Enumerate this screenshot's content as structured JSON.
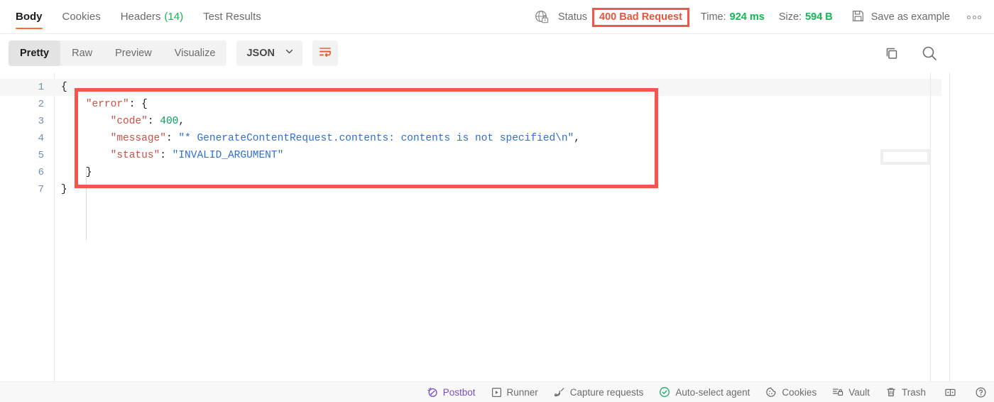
{
  "response_tabs": [
    {
      "label": "Body",
      "count": "",
      "active": true
    },
    {
      "label": "Cookies",
      "count": "",
      "active": false
    },
    {
      "label": "Headers",
      "count": "(14)",
      "active": false
    },
    {
      "label": "Test Results",
      "count": "",
      "active": false
    }
  ],
  "meta": {
    "security_icon": "globe-lock-icon",
    "status_label": "Status",
    "status_value": "400 Bad Request",
    "status_color": "#e8553c",
    "highlight_color": "#f4564f",
    "time_label": "Time:",
    "time_value": "924 ms",
    "size_label": "Size:",
    "size_value": "594 B",
    "value_color": "#0cbb52",
    "save_as_example": "Save as example",
    "more_options": "more-options-icon"
  },
  "view_toolbar": {
    "modes": [
      {
        "label": "Pretty",
        "active": true
      },
      {
        "label": "Raw",
        "active": false
      },
      {
        "label": "Preview",
        "active": false
      },
      {
        "label": "Visualize",
        "active": false
      }
    ],
    "format": "JSON",
    "wrap_lines_icon": "wrap-lines-icon",
    "copy_icon": "copy-icon",
    "search_icon": "search-icon",
    "accent_color": "#ff6c37"
  },
  "code": {
    "language": "json",
    "lines": [
      {
        "num": "1",
        "indent": 0,
        "highlight": true,
        "tokens": [
          {
            "t": "{",
            "c": "p"
          }
        ]
      },
      {
        "num": "2",
        "indent": 1,
        "highlight": false,
        "tokens": [
          {
            "t": "\"error\"",
            "c": "k"
          },
          {
            "t": ": {",
            "c": "p"
          }
        ]
      },
      {
        "num": "3",
        "indent": 2,
        "highlight": false,
        "tokens": [
          {
            "t": "\"code\"",
            "c": "k"
          },
          {
            "t": ": ",
            "c": "p"
          },
          {
            "t": "400",
            "c": "n"
          },
          {
            "t": ",",
            "c": "p"
          }
        ]
      },
      {
        "num": "4",
        "indent": 2,
        "highlight": false,
        "tokens": [
          {
            "t": "\"message\"",
            "c": "k"
          },
          {
            "t": ": ",
            "c": "p"
          },
          {
            "t": "\"* GenerateContentRequest.contents: contents is not specified\\n\"",
            "c": "s"
          },
          {
            "t": ",",
            "c": "p"
          }
        ]
      },
      {
        "num": "5",
        "indent": 2,
        "highlight": false,
        "tokens": [
          {
            "t": "\"status\"",
            "c": "k"
          },
          {
            "t": ": ",
            "c": "p"
          },
          {
            "t": "\"INVALID_ARGUMENT\"",
            "c": "s"
          }
        ]
      },
      {
        "num": "6",
        "indent": 1,
        "highlight": false,
        "tokens": [
          {
            "t": "}",
            "c": "p"
          }
        ]
      },
      {
        "num": "7",
        "indent": 0,
        "highlight": false,
        "tokens": [
          {
            "t": "}",
            "c": "p"
          }
        ]
      }
    ],
    "raw_body": "{\n    \"error\": {\n        \"code\": 400,\n        \"message\": \"* GenerateContentRequest.contents: contents is not specified\\n\",\n        \"status\": \"INVALID_ARGUMENT\"\n    }\n}"
  },
  "footer": {
    "items": [
      {
        "label": "Postbot",
        "icon": "postbot-icon"
      },
      {
        "label": "Runner",
        "icon": "runner-play-icon"
      },
      {
        "label": "Capture requests",
        "icon": "satellite-icon"
      },
      {
        "label": "Auto-select agent",
        "icon": "check-circle-icon"
      },
      {
        "label": "Cookies",
        "icon": "cookie-icon"
      },
      {
        "label": "Vault",
        "icon": "vault-lock-icon"
      },
      {
        "label": "Trash",
        "icon": "trash-icon"
      }
    ],
    "icon_only": [
      {
        "icon": "layout-panel-icon"
      },
      {
        "icon": "help-circle-icon"
      }
    ]
  }
}
